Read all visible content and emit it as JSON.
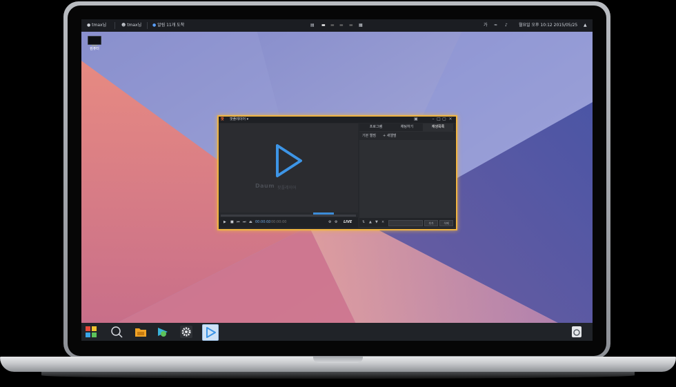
{
  "top_panel": {
    "user_btn": "tmax님",
    "user_btn2": "tmax님",
    "notice": "알림 11개 도착",
    "ime": "가",
    "day": "월요일",
    "time": "오후 10:12",
    "date": "2015/05/25"
  },
  "desktop": {
    "icon_label": "컴퓨터"
  },
  "player": {
    "title_logo": "팟",
    "title": "팟플레이어 ▾",
    "brand": "Daum",
    "brand2": "팟플레이어",
    "time_current": "00:00:00",
    "time_total": "00:00:00",
    "live": "LIVE",
    "tabs": [
      "프로그램",
      "채팅하기",
      "재생목록"
    ],
    "playlist_header": "기본 앨범",
    "playlist_add": "+ 새앨범",
    "bottom_btn1": "추가",
    "bottom_btn2": "삭제"
  },
  "colors": {
    "accent": "#f0b442",
    "play_blue": "#3d95e6"
  }
}
